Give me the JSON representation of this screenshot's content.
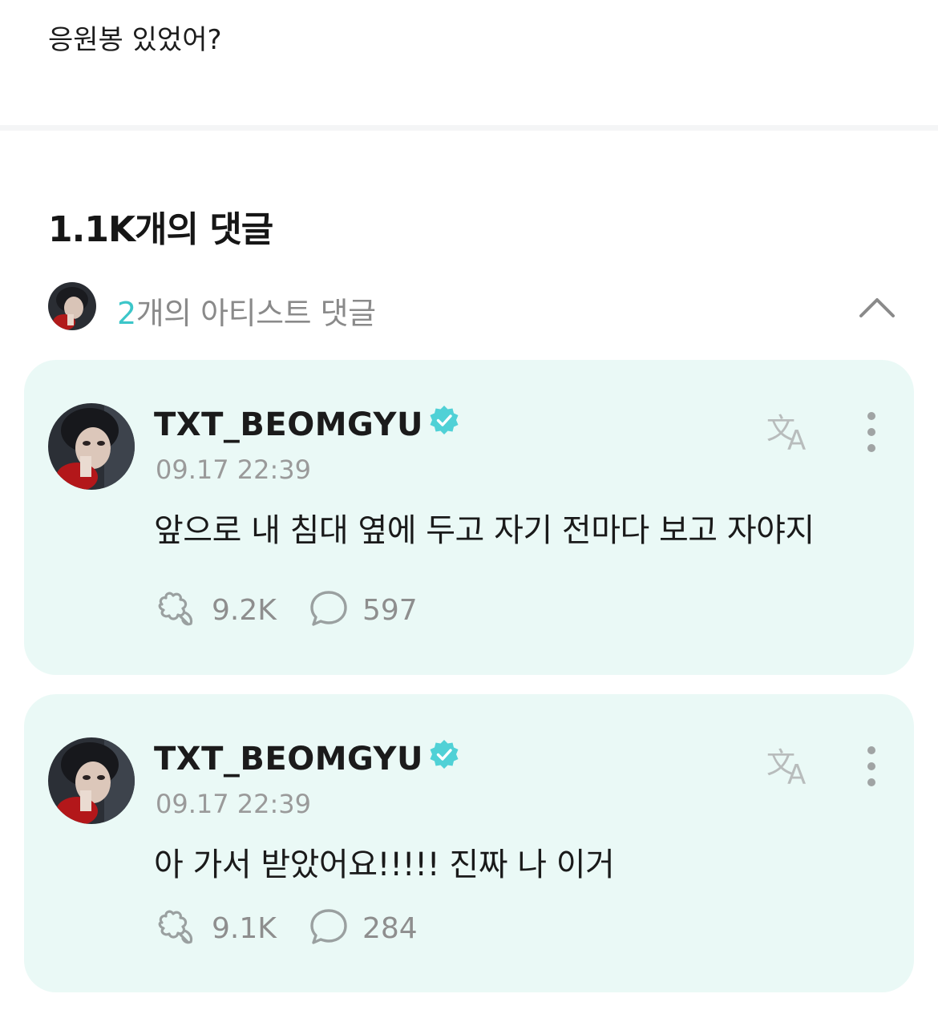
{
  "post": {
    "text": "응원봉 있었어?"
  },
  "comments_section": {
    "heading": "1.1K개의 댓글",
    "artist_comments": {
      "count": "2",
      "label_suffix": "개의 아티스트 댓글"
    }
  },
  "comments": [
    {
      "username": "TXT_BEOMGYU",
      "verified": true,
      "timestamp": "09.17 22:39",
      "text": "앞으로 내 침대 옆에 두고 자기 전마다 보고 자야지",
      "likes": "9.2K",
      "replies": "597"
    },
    {
      "username": "TXT_BEOMGYU",
      "verified": true,
      "timestamp": "09.17 22:39",
      "text": "아 가서 받았어요!!!!! 진짜 나 이거",
      "likes": "9.1K",
      "replies": "284"
    }
  ],
  "colors": {
    "accent": "#3cc6c9",
    "card_bg": "#eaf9f6",
    "verified": "#50d1d6"
  },
  "icons": [
    "chevron-up-icon",
    "verified-badge-icon",
    "translate-icon",
    "more-vertical-icon",
    "cheer-icon",
    "comment-bubble-icon"
  ]
}
